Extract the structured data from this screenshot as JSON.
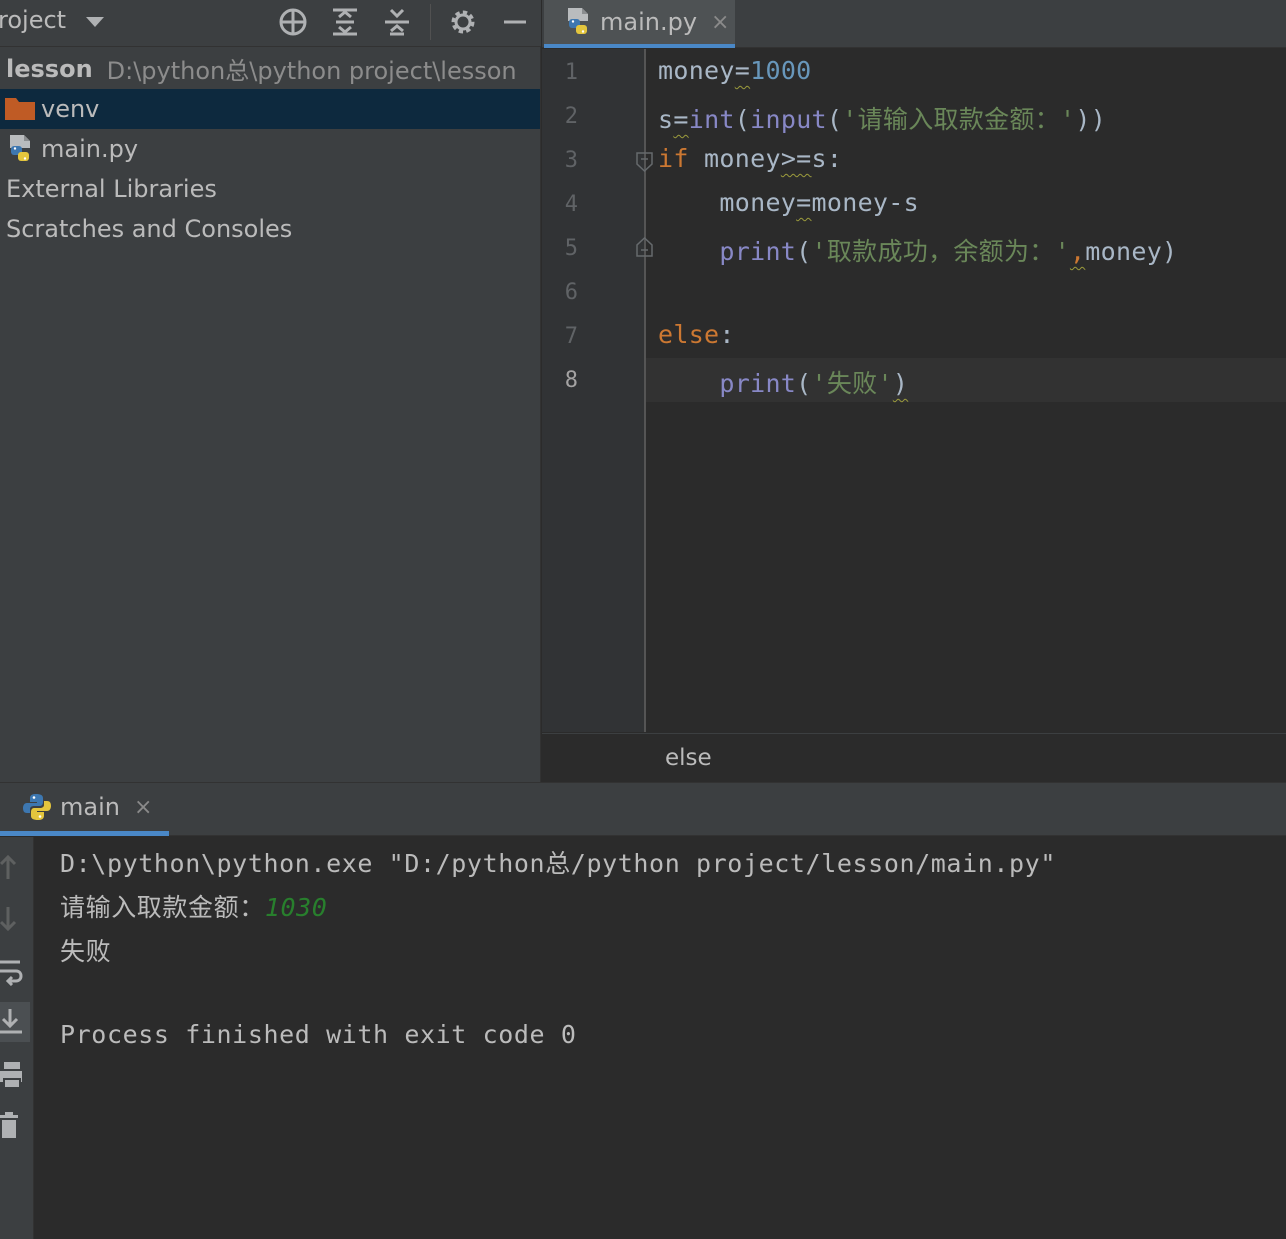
{
  "project_panel": {
    "title": "roject",
    "toolbar_icons": [
      "locate-icon",
      "expand-all-icon",
      "collapse-all-icon",
      "gear-icon",
      "minimize-icon"
    ],
    "root": {
      "name": "lesson",
      "path": "D:\\python总\\python project\\lesson"
    },
    "items": [
      {
        "label": "venv",
        "icon": "folder-icon",
        "selected": true
      },
      {
        "label": "main.py",
        "icon": "python-file-icon",
        "selected": false
      },
      {
        "label": "External Libraries",
        "icon": "",
        "selected": false
      },
      {
        "label": "Scratches and Consoles",
        "icon": "",
        "selected": false
      }
    ]
  },
  "editor": {
    "tab": {
      "label": "main.py",
      "close": "×"
    },
    "line_numbers": [
      "1",
      "2",
      "3",
      "4",
      "5",
      "6",
      "7",
      "8"
    ],
    "current_line": "8",
    "code": {
      "l1": {
        "a": "money",
        "b": "=",
        "c": "1000"
      },
      "l2": {
        "a": "s",
        "b": "=",
        "c": "int",
        "d": "(",
        "e": "input",
        "f": "(",
        "g": "'请输入取款金额：'",
        "h": "))"
      },
      "l3": {
        "a": "if",
        "b": " money",
        "c": ">=",
        "d": "s:"
      },
      "l4": {
        "a": "    money",
        "b": "=",
        "c": "money-s"
      },
      "l5": {
        "a": "    ",
        "b": "print",
        "c": "(",
        "d": "'取款成功，余额为：'",
        "e": ",",
        "f": "money)"
      },
      "l6": {
        "a": ""
      },
      "l7": {
        "a": "else",
        "b": ":"
      },
      "l8": {
        "a": "    ",
        "b": "print",
        "c": "(",
        "d": "'失败'",
        "e": ")"
      }
    },
    "breadcrumb": "else"
  },
  "run_window": {
    "tab": {
      "label": "main",
      "close": "×"
    },
    "side_icons": [
      "up-arrow-icon",
      "down-arrow-icon",
      "soft-wrap-icon",
      "scroll-to-end-icon",
      "print-icon",
      "trash-icon"
    ],
    "console": {
      "command": "D:\\python\\python.exe \"D:/python总/python project/lesson/main.py\"",
      "prompt": "请输入取款金额：",
      "input_value": "1030",
      "output": "失败",
      "exit_message": "Process finished with exit code 0"
    }
  },
  "colors": {
    "panel_bg": "#3c3f41",
    "editor_bg": "#2b2b2b",
    "selection": "#0d293e",
    "accent_tab": "#4a88c7",
    "keyword": "#cc7832",
    "number": "#6897bb",
    "builtin": "#8888c6",
    "string": "#6a8759",
    "console_input": "#287f2d"
  }
}
